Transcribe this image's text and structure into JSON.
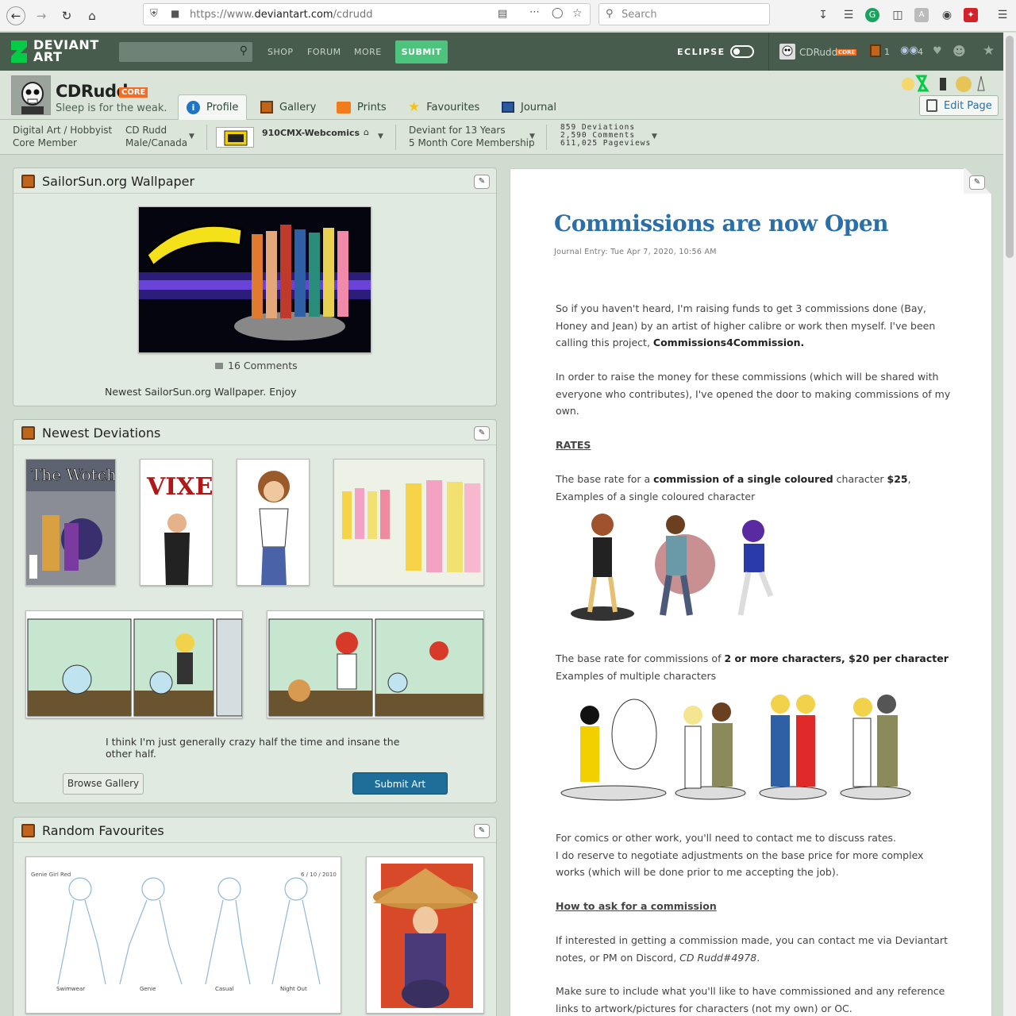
{
  "browser": {
    "url": "https://www.deviantart.com/cdrudd",
    "url_prefix": "https://www.",
    "url_host": "deviantart.com",
    "url_path": "/cdrudd",
    "search_placeholder": "Search"
  },
  "header": {
    "logo_line1": "DEVIANT",
    "logo_line2": "ART",
    "nav": [
      "SHOP",
      "FORUM",
      "MORE"
    ],
    "submit_label": "SUBMIT",
    "eclipse_label": "ECLIPSE",
    "username": "CDRudd",
    "core_badge": "CORE",
    "notif_count_1": "1",
    "notif_count_2": "4"
  },
  "profile": {
    "name": "CDRudd",
    "core_badge": "CORE",
    "tagline": "Sleep is for the weak.",
    "tabs": [
      "Profile",
      "Gallery",
      "Prints",
      "Favourites",
      "Journal"
    ],
    "edit_page": "Edit Page"
  },
  "infobar": {
    "role_line1": "Digital Art / Hobbyist",
    "role_line2": "Core Member",
    "name_line1": "CD Rudd",
    "name_line2": "Male/Canada",
    "group": "910CMX-Webcomics",
    "deviant_line1": "Deviant for 13 Years",
    "deviant_line2": "5 Month Core Membership",
    "stat1": "859 Deviations",
    "stat2": "2,590 Comments",
    "stat3": "611,025 Pageviews"
  },
  "wallpaper_box": {
    "title": "SailorSun.org Wallpaper",
    "comments": "16 Comments",
    "caption": "Newest SailorSun.org Wallpaper. Enjoy"
  },
  "newest_box": {
    "title": "Newest Deviations",
    "quote": "I think I'm just generally crazy half the time and insane the other half.",
    "browse_label": "Browse Gallery",
    "submit_label": "Submit Art"
  },
  "favourites_box": {
    "title": "Random Favourites",
    "sketch_title": "Genie Girl Red",
    "sketch_date": "6 / 10 / 2010",
    "sketch_labels": [
      "Swimwear",
      "Genie",
      "Casual",
      "Night Out"
    ]
  },
  "journal": {
    "title": "Commissions are now Open",
    "meta": "Journal Entry: Tue Apr 7, 2020, 10:56 AM",
    "p1_a": "So if you haven't heard, I'm raising funds to get 3 commissions done (Bay, Honey and Jean) by an artist of higher calibre or work then myself. I've been calling this project, ",
    "p1_b": "Commissions4Commission.",
    "p2": "In order to raise the money for these commissions (which will be shared with everyone who contributes), I've opened the door to making commissions of my own.",
    "rates": "RATES",
    "p3_a": "The base rate for a ",
    "p3_b": "commission of a single coloured",
    "p3_c": " character ",
    "p3_d": "$25",
    "p3_e": ",",
    "p3_f": "Examples of a single coloured character",
    "p4_a": "The base rate for commissions of ",
    "p4_b": "2 or more characters, $20 per character",
    "p4_c": "Examples of multiple characters",
    "p5_a": "For comics or other work, you'll need to contact me to discuss rates.",
    "p5_b": "I do reserve to negotiate adjustments on the base price for more complex works (which will be done prior to me accepting the job).",
    "how": "How to ask for a commission",
    "p6_a": "If interested in getting a commission made, you can contact me via Deviantart notes, or PM on Discord, ",
    "p6_b": "CD Rudd#4978",
    "p6_c": ".",
    "p7": "Make sure to include what you'll like to have commissioned and any reference links to artwork/pictures for characters (not my own) or OC."
  }
}
